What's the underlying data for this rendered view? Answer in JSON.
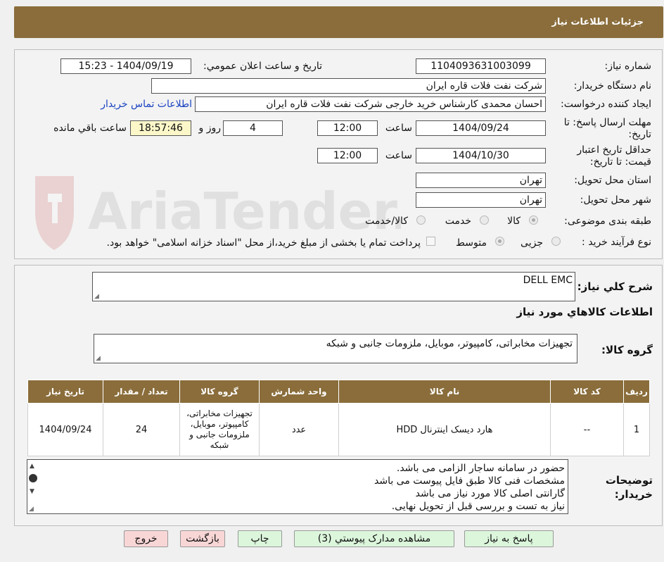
{
  "header": {
    "title": "جزئیات اطلاعات نیاز"
  },
  "watermark": {
    "brand": "AriaTender.neT"
  },
  "form": {
    "need_number_label": "شماره نیاز:",
    "need_number": "1104093631003099",
    "announce_label": "تاریخ و ساعت اعلان عمومي:",
    "announce_value": "1404/09/19 - 15:23",
    "buyer_org_label": "نام دستگاه خريدار:",
    "buyer_org": "شرکت نفت فلات قاره ایران",
    "requester_label": "ایجاد کننده درخواست:",
    "requester": "احسان محمدی کارشناس خرید خارجی شرکت نفت فلات قاره ایران",
    "contact_link": "اطلاعات تماس خريدار",
    "deadline_label": "مهلت ارسال پاسخ: تا تاریخ:",
    "deadline_date": "1404/09/24",
    "time_label": "ساعت",
    "deadline_time": "12:00",
    "days_value": "4",
    "days_label": "روز و",
    "remaining_time": "18:57:46",
    "remaining_label": "ساعت باقي مانده",
    "validity_label": "حداقل تاریخ اعتبار قیمت: تا تاریخ:",
    "validity_date": "1404/10/30",
    "validity_time": "12:00",
    "province_label": "استان محل تحویل:",
    "province": "تهران",
    "city_label": "شهر محل تحویل:",
    "city": "تهران",
    "category_label": "طبقه بندی موضوعی:",
    "category_options": [
      "کالا",
      "خدمت",
      "کالا/خدمت"
    ],
    "category_selected": "کالا",
    "process_label": "نوع فرآیند خرید :",
    "process_options": [
      "جزیی",
      "متوسط"
    ],
    "process_selected": "متوسط",
    "payment_note": "پرداخت تمام یا بخشی از مبلغ خرید،از محل \"اسناد خزانه اسلامی\" خواهد بود."
  },
  "details": {
    "summary_label": "شرح کلي نیاز:",
    "summary_value": "DELL EMC",
    "goods_info_title": "اطلاعات کالاهاي مورد نیاز",
    "goods_group_label": "گروه کالا:",
    "goods_group_value": "تجهیزات مخابراتی، کامپیوتر، موبایل، ملزومات جانبی و شبکه"
  },
  "table": {
    "headers": [
      "ردیف",
      "کد کالا",
      "نام کالا",
      "واحد شمارش",
      "گروه کالا",
      "تعداد / مقدار",
      "تاریخ نیاز"
    ],
    "rows": [
      {
        "row": "1",
        "code": "--",
        "name": "هارد دیسک اینترنال HDD",
        "unit": "عدد",
        "group": "تجهیزات مخابراتی، کامپیوتر، موبایل، ملزومات جانبی و شبکه",
        "qty": "24",
        "date": "1404/09/24"
      }
    ]
  },
  "notes": {
    "label": "توضیحات خریدار:",
    "lines": [
      "حضور در سامانه ساجار الزامی می باشد.",
      "مشخصات فنی کالا طبق فایل پیوست می باشد",
      "گارانتی اصلی کالا مورد نیاز می باشد",
      "نیاز به تست و بررسی قبل از تحویل نهایی."
    ]
  },
  "buttons": {
    "respond": "پاسخ به نیاز",
    "attachments": "مشاهده مدارک پیوستي (3)",
    "print": "چاپ",
    "back": "بازگشت",
    "exit": "خروج"
  },
  "colors": {
    "header_bg": "#8a6d3b",
    "green_button": "#dcf6dc",
    "pink_button": "#f9d6d6",
    "countdown_bg": "#fcf7c9",
    "link": "#1a43c2"
  }
}
